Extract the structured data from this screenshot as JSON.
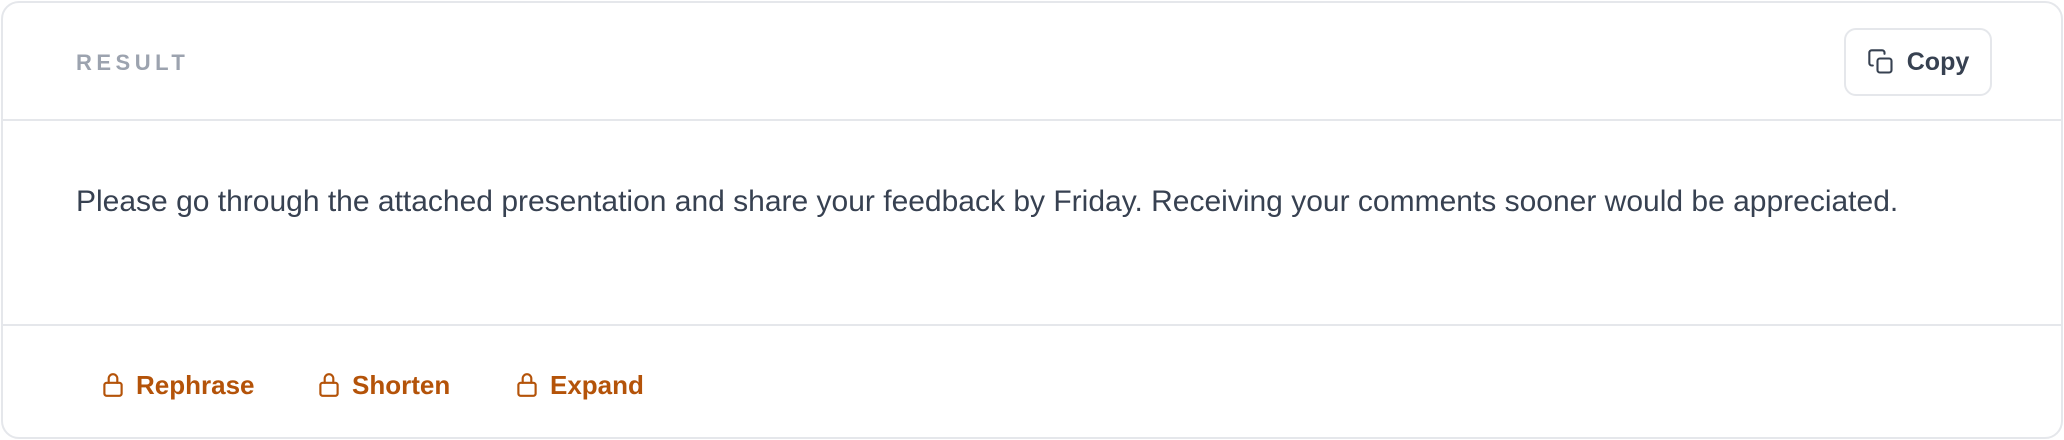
{
  "header": {
    "title": "RESULT",
    "copy_label": "Copy",
    "copy_icon": "copy-icon"
  },
  "result": {
    "text": "Please go through the attached presentation and share your feedback by Friday. Receiving your comments sooner would be appreciated."
  },
  "actions": [
    {
      "label": "Rephrase",
      "icon": "lock-icon",
      "locked": true
    },
    {
      "label": "Shorten",
      "icon": "lock-icon",
      "locked": true
    },
    {
      "label": "Expand",
      "icon": "lock-icon",
      "locked": true
    }
  ],
  "colors": {
    "accent": "#b45309",
    "text": "#374151",
    "muted": "#9ca3af",
    "border": "#e5e7eb"
  }
}
